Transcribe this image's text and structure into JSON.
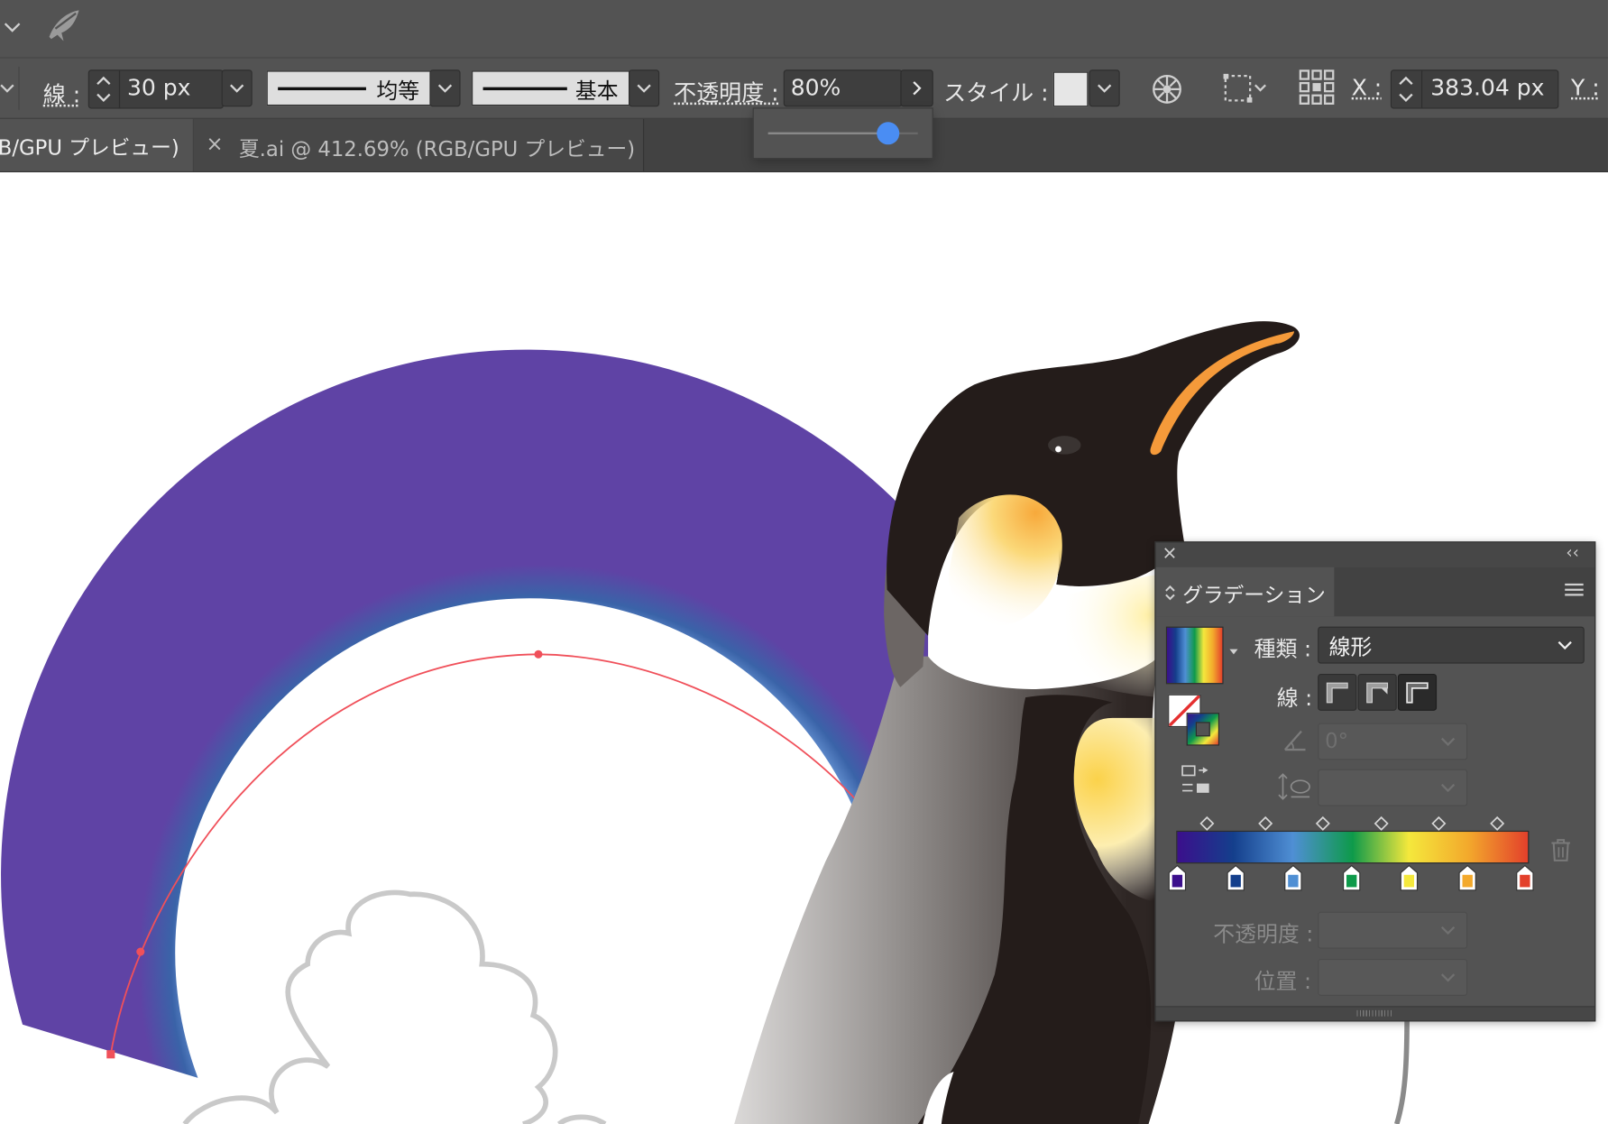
{
  "control_bar": {
    "stroke_label": "線 :",
    "stroke_value": "30 px",
    "profile_label": "均等",
    "brush_label": "基本",
    "opacity_label": "不透明度 :",
    "opacity_value": "80%",
    "opacity_slider_fraction": 0.8,
    "style_label": "スタイル :",
    "x_label": "X :",
    "x_value": "383.04 px",
    "y_label": "Y :"
  },
  "tabs": [
    {
      "label": "B/GPU プレビュー)",
      "active": true
    },
    {
      "close": "×",
      "label": "夏.ai @ 412.69% (RGB/GPU プレビュー)",
      "active": false
    }
  ],
  "gradient_panel": {
    "close": "×",
    "collapse": "‹‹",
    "title": "グラデーション",
    "menu_icon": "hamburger-icon",
    "type_label": "種類 :",
    "type_value": "線形",
    "stroke_label": "線 :",
    "angle_value": "0°",
    "opacity_label": "不透明度 :",
    "location_label": "位置 :",
    "stops": [
      "#3b0f8c",
      "#143f8c",
      "#4f8fd4",
      "#0e9a4a",
      "#f4e83c",
      "#f3a92c",
      "#e3402b"
    ]
  },
  "colors": {
    "chrome": "#535353",
    "chrome_dark": "#474747",
    "accent_blue": "#4a8df3",
    "path_red": "#f0505a"
  }
}
